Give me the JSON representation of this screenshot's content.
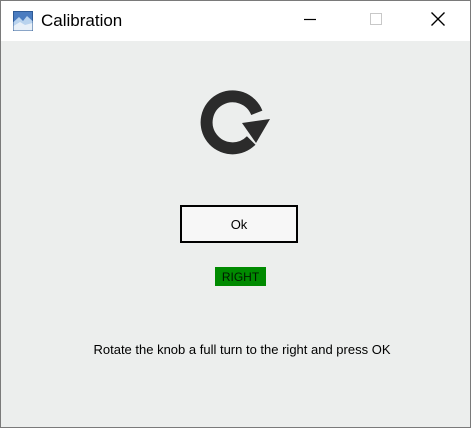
{
  "window": {
    "title": "Calibration",
    "controls": {
      "minimize_icon": "minimize-icon",
      "maximize_icon": "maximize-icon",
      "close_icon": "close-icon"
    }
  },
  "main": {
    "rotate_icon": "rotate-clockwise-icon",
    "ok_button_label": "Ok",
    "status_text": "RIGHT",
    "status_color": "#008a00",
    "instruction_text": "Rotate the knob a full turn to the right and press OK"
  }
}
